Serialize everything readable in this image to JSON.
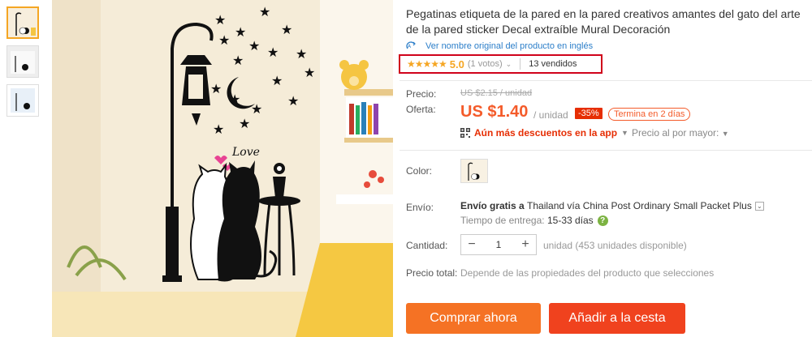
{
  "product": {
    "title": "Pegatinas etiqueta de la pared en la pared creativos amantes del gato del arte de la pared sticker Decal extraíble Mural Decoración",
    "original_name_link": "Ver nombre original del producto en inglés",
    "rating": {
      "stars": "★★★★★",
      "score": "5.0",
      "votes": "(1 votos)",
      "sold": "13 vendidos"
    }
  },
  "pricing": {
    "price_label": "Precio:",
    "old_price": "US $2.15 / unidad",
    "offer_label": "Oferta:",
    "current_price": "US $1.40",
    "unit": "/ unidad",
    "discount": "-35%",
    "ends": "Termina en 2 días",
    "app_discount": "Aún más descuentos en la app",
    "wholesale": "Precio al por mayor:"
  },
  "options": {
    "color_label": "Color:",
    "shipping_label": "Envío:",
    "shipping_free": "Envío gratis a",
    "shipping_dest": "Thailand vía China Post Ordinary Small Packet Plus",
    "delivery_label": "Tiempo de entrega:",
    "delivery_days": "15-33 días",
    "quantity_label": "Cantidad:",
    "quantity": "1",
    "availability": "unidad (453 unidades disponible)",
    "total_label": "Precio total:",
    "total_note": "Depende de las propiedades del producto que selecciones"
  },
  "actions": {
    "buy_now": "Comprar ahora",
    "add_to_cart": "Añadir a la cesta"
  },
  "colors": {
    "accent": "#f45b2a",
    "buy": "#f57224",
    "cart": "#f0421e",
    "star": "#f5a623",
    "highlight_box": "#d0021b"
  }
}
